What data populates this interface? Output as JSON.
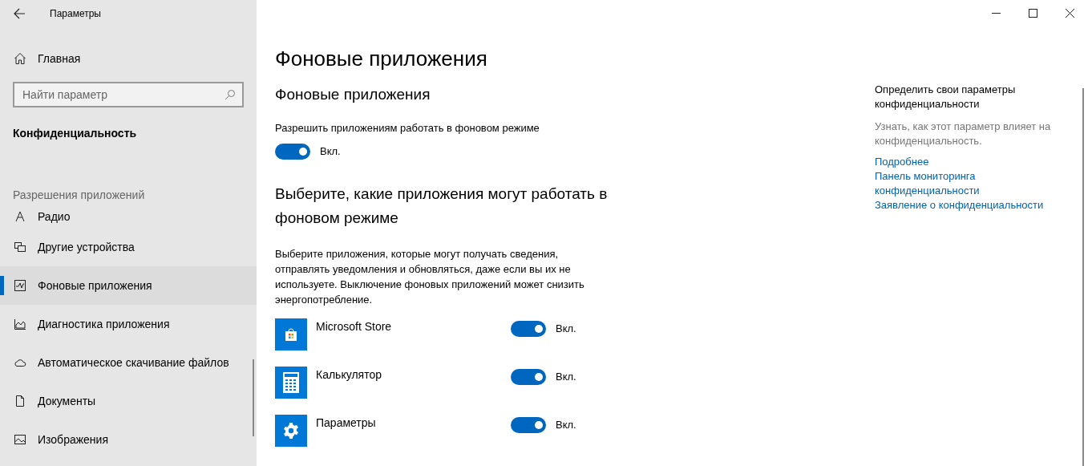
{
  "window": {
    "title": "Параметры"
  },
  "sidebar": {
    "home": "Главная",
    "search": {
      "placeholder": "Найти параметр"
    },
    "category": "Конфиденциальность",
    "section": "Разрешения приложений",
    "items": [
      {
        "label": "Радио",
        "kind": "radio",
        "selected": false
      },
      {
        "label": "Другие устройства",
        "kind": "devices",
        "selected": false
      },
      {
        "label": "Фоновые приложения",
        "kind": "background",
        "selected": true
      },
      {
        "label": "Диагностика приложения",
        "kind": "diagnostics",
        "selected": false
      },
      {
        "label": "Автоматическое скачивание файлов",
        "kind": "cloud",
        "selected": false
      },
      {
        "label": "Документы",
        "kind": "document",
        "selected": false
      },
      {
        "label": "Изображения",
        "kind": "image",
        "selected": false
      }
    ]
  },
  "main": {
    "title": "Фоновые приложения",
    "subtitle": "Фоновые приложения",
    "allow": {
      "label": "Разрешить приложениям работать в фоновом режиме",
      "on": true,
      "state": "Вкл."
    },
    "choose_heading": "Выберите, какие приложения могут работать в фоновом режиме",
    "description": "Выберите приложения, которые могут получать сведения, отправлять уведомления и обновляться, даже если вы их не используете. Выключение фоновых приложений может снизить энергопотребление.",
    "apps": [
      {
        "name": "Microsoft Store",
        "kind": "store",
        "on": true,
        "state": "Вкл."
      },
      {
        "name": "Калькулятор",
        "kind": "calculator",
        "on": true,
        "state": "Вкл."
      },
      {
        "name": "Параметры",
        "kind": "settings",
        "on": true,
        "state": "Вкл."
      }
    ]
  },
  "aside": {
    "heading": "Определить свои параметры конфиденциальности",
    "text": "Узнать, как этот параметр влияет на конфиденциальность.",
    "links": [
      "Подробнее",
      "Панель мониторинга конфиденциальности",
      "Заявление о конфиденциальности"
    ]
  }
}
